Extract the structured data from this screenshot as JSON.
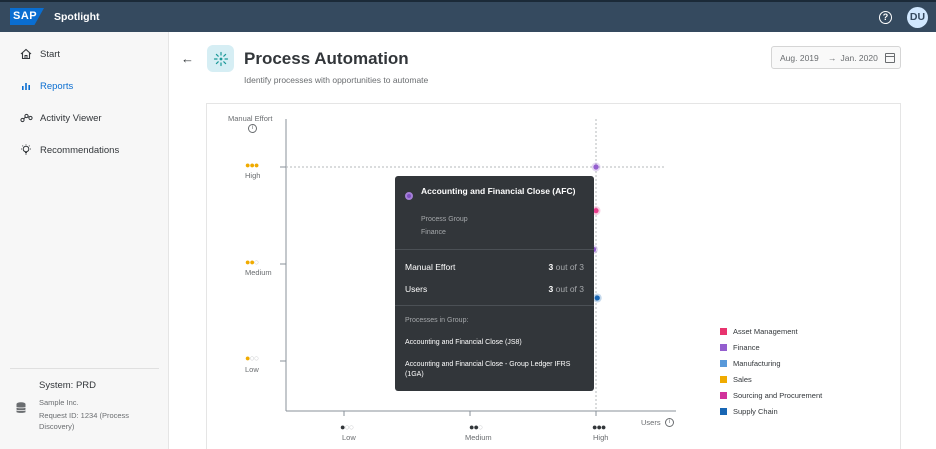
{
  "header": {
    "logo_text": "SAP",
    "app_name": "Spotlight",
    "help_symbol": "?",
    "avatar_initials": "DU"
  },
  "sidebar": {
    "items": [
      {
        "label": "Start",
        "icon": "home-icon",
        "active": false
      },
      {
        "label": "Reports",
        "icon": "bar-chart-icon",
        "active": true
      },
      {
        "label": "Activity Viewer",
        "icon": "activity-icon",
        "active": false
      },
      {
        "label": "Recommendations",
        "icon": "lightbulb-icon",
        "active": false
      }
    ],
    "system": {
      "title": "System: PRD",
      "company": "Sample Inc.",
      "request": "Request ID: 1234 (Process Discovery)"
    }
  },
  "page": {
    "back_symbol": "←",
    "title": "Process Automation",
    "subtitle": "Identify processes with opportunities to automate",
    "date_from": "Aug. 2019",
    "date_arrow": "→",
    "date_to": "Jan. 2020"
  },
  "chart": {
    "y_title": "Manual Effort",
    "x_title": "Users",
    "y_levels": [
      {
        "dots": "●●●",
        "label": "High"
      },
      {
        "dots": "●●○",
        "label": "Medium"
      },
      {
        "dots": "●○○",
        "label": "Low"
      }
    ],
    "x_levels": [
      {
        "dots": "●○○",
        "label": "Low"
      },
      {
        "dots": "●●○",
        "label": "Medium"
      },
      {
        "dots": "●●●",
        "label": "High"
      }
    ],
    "dot_active_color": "#f0ab00",
    "dot_x_color": "#32363a"
  },
  "chart_data": {
    "type": "scatter",
    "xlabel": "Users",
    "ylabel": "Manual Effort",
    "x_categories": [
      "Low",
      "Medium",
      "High"
    ],
    "y_categories": [
      "Low",
      "Medium",
      "High"
    ],
    "points": [
      {
        "group": "Finance",
        "users": 3,
        "effort": 3,
        "color": "#945ecf"
      },
      {
        "group": "Sourcing and Procurement",
        "users": 3,
        "effort": 2.55,
        "color": "#e83e8c"
      },
      {
        "group": "Finance",
        "users": 2.98,
        "effort": 2.15,
        "color": "#945ecf"
      },
      {
        "group": "Supply Chain",
        "users": 3.01,
        "effort": 1.65,
        "color": "#1866b4"
      }
    ]
  },
  "tooltip": {
    "title": "Accounting and Financial Close (AFC)",
    "group_label": "Process Group",
    "group_value": "Finance",
    "effort_label": "Manual Effort",
    "effort_value": "3",
    "effort_suffix": "out of 3",
    "users_label": "Users",
    "users_value": "3",
    "users_suffix": "out of 3",
    "processes_label": "Processes in Group:",
    "processes": [
      "Accounting and Financial Close (JS8)",
      "Accounting and Financial Close - Group Ledger IFRS (1GA)"
    ]
  },
  "legend": [
    {
      "label": "Asset Management",
      "color": "#e8336e"
    },
    {
      "label": "Finance",
      "color": "#945ecf"
    },
    {
      "label": "Manufacturing",
      "color": "#5899da"
    },
    {
      "label": "Sales",
      "color": "#f0ab00"
    },
    {
      "label": "Sourcing and Procurement",
      "color": "#d1329b"
    },
    {
      "label": "Supply Chain",
      "color": "#1866b4"
    }
  ]
}
